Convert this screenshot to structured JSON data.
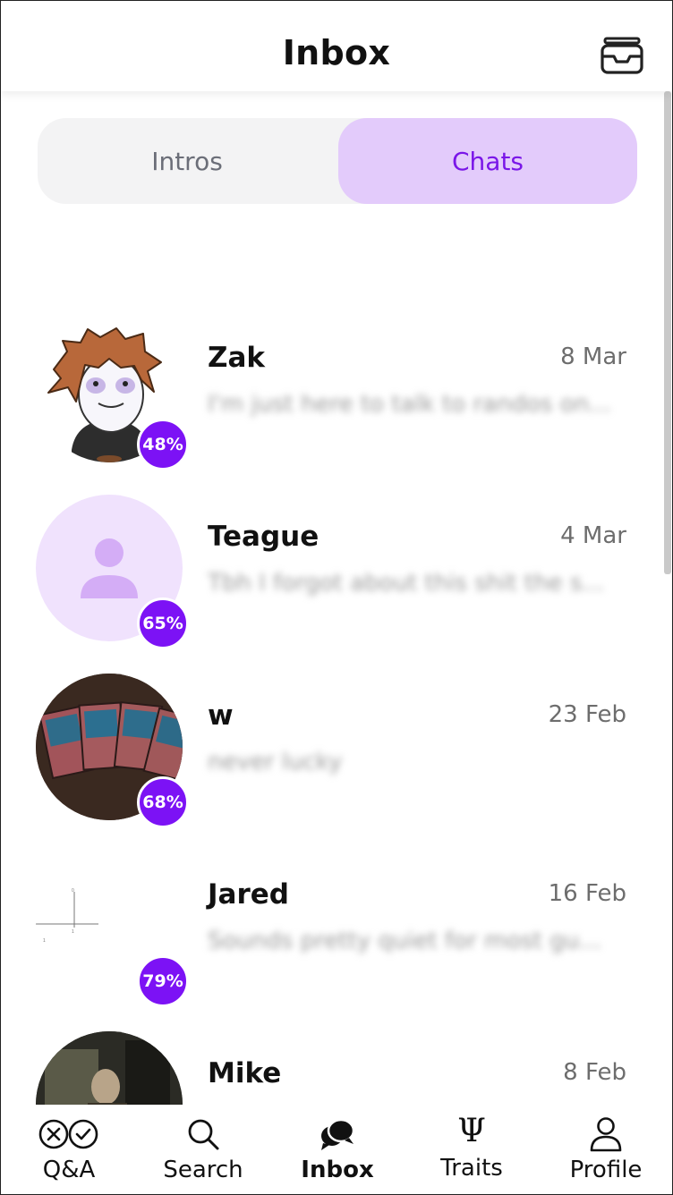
{
  "header": {
    "title": "Inbox",
    "archive_icon": "archive-tray-icon"
  },
  "tabs": [
    {
      "label": "Intros",
      "active": false
    },
    {
      "label": "Chats",
      "active": true
    }
  ],
  "colors": {
    "accent": "#7c12f5",
    "accent_text": "#7a16e8",
    "tab_active_bg": "#e3cbfb",
    "tab_bg": "#f3f3f4"
  },
  "chats": [
    {
      "name": "Zak",
      "date": "8 Mar",
      "preview": "I'm just here to talk to randos on...",
      "match": "48%",
      "avatar": "cartoon-drawing"
    },
    {
      "name": "Teague",
      "date": "4 Mar",
      "preview": "Tbh I forgot about this shit the s...",
      "match": "65%",
      "avatar": "default-person"
    },
    {
      "name": "w",
      "date": "23 Feb",
      "preview": "never lucky",
      "match": "68%",
      "avatar": "cards-photo"
    },
    {
      "name": "Jared",
      "date": "16 Feb",
      "preview": "Sounds pretty quiet for most gu...",
      "match": "79%",
      "avatar": "axes-sketch"
    },
    {
      "name": "Mike",
      "date": "8 Feb",
      "preview": "",
      "match": "",
      "avatar": "portrait-photo"
    }
  ],
  "nav": [
    {
      "label": "Q&A",
      "icon": "qa-icon",
      "active": false
    },
    {
      "label": "Search",
      "icon": "search-icon",
      "active": false
    },
    {
      "label": "Inbox",
      "icon": "chat-bubbles-icon",
      "active": true
    },
    {
      "label": "Traits",
      "icon": "psi-icon",
      "active": false
    },
    {
      "label": "Profile",
      "icon": "person-icon",
      "active": false
    }
  ]
}
